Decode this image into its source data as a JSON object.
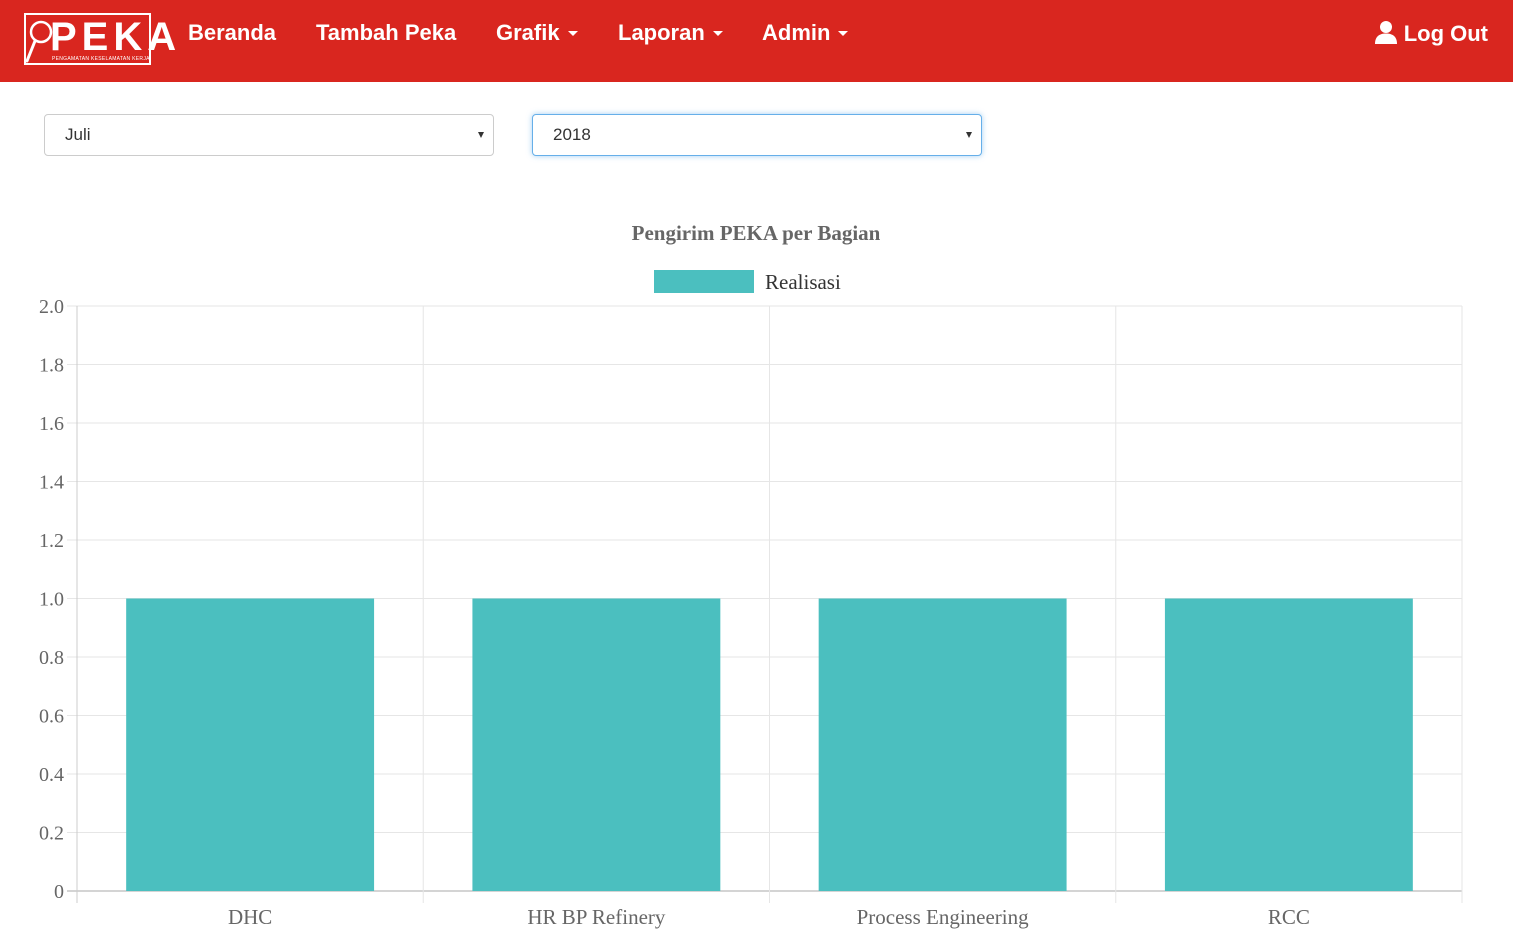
{
  "brand": {
    "name": "PEKA",
    "subtitle": "PENGAMATAN KESELAMATAN KERJA"
  },
  "nav": {
    "items": [
      {
        "label": "Beranda",
        "dropdown": false
      },
      {
        "label": "Tambah Peka",
        "dropdown": false
      },
      {
        "label": "Grafik",
        "dropdown": true
      },
      {
        "label": "Laporan",
        "dropdown": true
      },
      {
        "label": "Admin",
        "dropdown": true
      }
    ],
    "logout_label": "Log Out"
  },
  "filters": {
    "month": {
      "value": "Juli"
    },
    "year": {
      "value": "2018"
    }
  },
  "colors": {
    "navbar": "#d9261f",
    "bar": "#4bbfbf",
    "focus_border": "#66afe9"
  },
  "chart_data": {
    "type": "bar",
    "title": "Pengirim PEKA per Bagian",
    "legend_position": "top",
    "categories": [
      "DHC",
      "HR BP Refinery",
      "Process Engineering",
      "RCC"
    ],
    "series": [
      {
        "name": "Realisasi",
        "values": [
          1,
          1,
          1,
          1
        ]
      }
    ],
    "yticks": [
      "0",
      "0.2",
      "0.4",
      "0.6",
      "0.8",
      "1.0",
      "1.2",
      "1.4",
      "1.6",
      "1.8",
      "2.0"
    ],
    "ylim": [
      0,
      2
    ],
    "grid": true
  }
}
